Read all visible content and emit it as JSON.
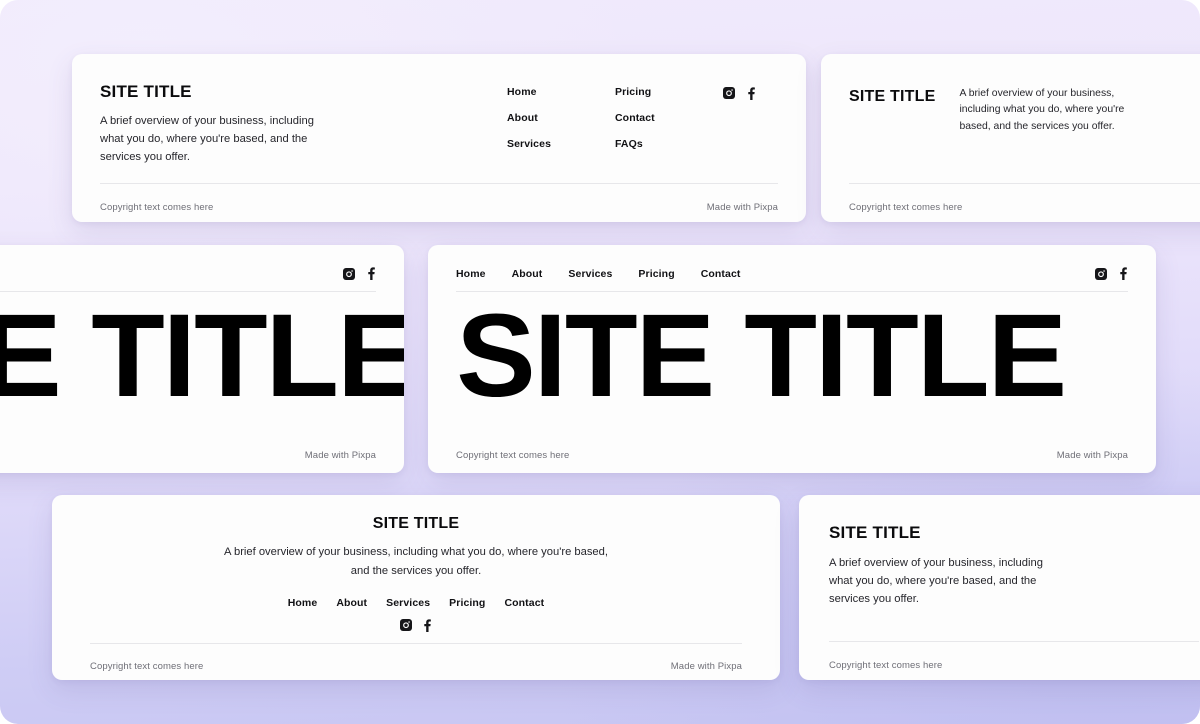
{
  "background": {
    "gradient_from": "#f0eafc",
    "gradient_to": "#c6c5f2"
  },
  "common": {
    "site_title": "SITE TITLE",
    "description": "A brief overview of your business, including what you do, where you're based, and the services you offer.",
    "copyright": "Copyright text comes here",
    "made_with": "Made with Pixpa",
    "instagram_icon": "instagram-icon",
    "facebook_icon": "facebook-icon"
  },
  "cards": [
    {
      "id": "card-nav-columns",
      "layout": "title-left-nav-columns",
      "title": "SITE TITLE",
      "description": "A brief overview of your business, including what you do, where you're based, and the services you offer.",
      "nav_column_1": [
        "Home",
        "About",
        "Services"
      ],
      "nav_column_2": [
        "Pricing",
        "Contact",
        "FAQs"
      ],
      "social": [
        "instagram-icon",
        "facebook-icon"
      ],
      "copyright": "Copyright text comes here",
      "made_with": "Made with Pixpa"
    },
    {
      "id": "card-split",
      "layout": "title-and-description-side-by-side",
      "title": "SITE TITLE",
      "description": "A brief overview of your business, including what you do, where you're based, and the services you offer.",
      "copyright": "Copyright text comes here"
    },
    {
      "id": "card-bigtitle-left",
      "layout": "oversized-title-social-only",
      "big_title": "SITE TITLE",
      "social": [
        "instagram-icon",
        "facebook-icon"
      ],
      "made_with": "Made with Pixpa"
    },
    {
      "id": "card-bigtitle-main",
      "layout": "oversized-title-with-topnav",
      "big_title": "SITE TITLE",
      "nav": [
        "Home",
        "About",
        "Services",
        "Pricing",
        "Contact"
      ],
      "social": [
        "instagram-icon",
        "facebook-icon"
      ],
      "copyright": "Copyright text comes here",
      "made_with": "Made with Pixpa"
    },
    {
      "id": "card-centered",
      "layout": "fully-centered",
      "title": "SITE TITLE",
      "description": "A brief overview of your business, including what you do, where you're based, and the services you offer.",
      "nav": [
        "Home",
        "About",
        "Services",
        "Pricing",
        "Contact"
      ],
      "social": [
        "instagram-icon",
        "facebook-icon"
      ],
      "copyright": "Copyright text comes here",
      "made_with": "Made with Pixpa"
    },
    {
      "id": "card-simple",
      "layout": "title-over-description",
      "title": "SITE TITLE",
      "description": "A brief overview of your business, including what you do, where you're based, and the services you offer.",
      "copyright": "Copyright text comes here"
    }
  ]
}
